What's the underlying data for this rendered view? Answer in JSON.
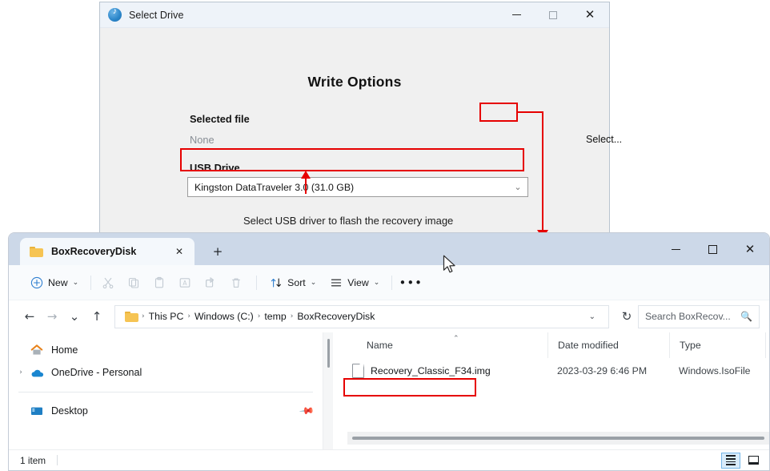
{
  "dialog": {
    "title": "Select Drive",
    "app_icon": "disc-icon",
    "heading": "Write Options",
    "selected_file_label": "Selected file",
    "selected_file_value": "None",
    "select_button": "Select...",
    "usb_drive_label": "USB Drive",
    "usb_drive_value": "Kingston DataTraveler 3.0 (31.0 GB)",
    "hint": "Select USB driver to flash the recovery image",
    "obscured_label": "USB Drive",
    "window_controls": {
      "minimize": "—",
      "maximize": "□",
      "close": "✕"
    }
  },
  "annotations": {
    "color": "#e60000",
    "boxes": [
      "select-button",
      "usb-drive-combo",
      "recovery-file-name"
    ]
  },
  "explorer": {
    "tab": {
      "title": "BoxRecoveryDisk",
      "close": "✕",
      "folder_icon": "folder-icon"
    },
    "new_tab": "+",
    "window_controls": {
      "minimize": "—",
      "maximize": "□",
      "close": "✕"
    },
    "toolbar": {
      "new_label": "New",
      "new_icon": "plus-circle-icon",
      "cut_icon": "scissors-icon",
      "copy_icon": "copy-icon",
      "paste_icon": "paste-icon",
      "rename_icon": "rename-icon",
      "share_icon": "share-icon",
      "delete_icon": "trash-icon",
      "sort_label": "Sort",
      "sort_icon": "sort-arrows-icon",
      "view_label": "View",
      "view_icon": "hamburger-icon",
      "more_label": "•••",
      "chevron": "⌄"
    },
    "address": {
      "back_icon": "←",
      "forward_icon": "→",
      "recent_icon": "⌄",
      "up_icon": "↑",
      "folder_icon": "folder-icon",
      "crumbs": [
        "This PC",
        "Windows (C:)",
        "temp",
        "BoxRecoveryDisk"
      ],
      "separator": "›",
      "dropdown_icon": "⌄",
      "refresh_icon": "↻"
    },
    "search": {
      "placeholder": "Search BoxRecov...",
      "icon": "search-icon"
    },
    "sidebar": [
      {
        "label": "Home",
        "icon": "home-icon",
        "chevron": "",
        "pin": ""
      },
      {
        "label": "OneDrive - Personal",
        "icon": "onedrive-icon",
        "chevron": "›",
        "pin": ""
      },
      {
        "label": "Desktop",
        "icon": "desktop-icon",
        "chevron": "",
        "pin": "📌"
      }
    ],
    "columns": [
      "Name",
      "Date modified",
      "Type"
    ],
    "sort_indicator": "⌃",
    "rows": [
      {
        "name": "Recovery_Classic_F34.img",
        "date_modified": "2023-03-29 6:46 PM",
        "type": "Windows.IsoFile",
        "icon": "file-icon"
      }
    ],
    "status": {
      "item_count": "1 item"
    },
    "view_buttons": {
      "details": "details-view-icon",
      "tiles": "large-icons-view-icon"
    }
  }
}
